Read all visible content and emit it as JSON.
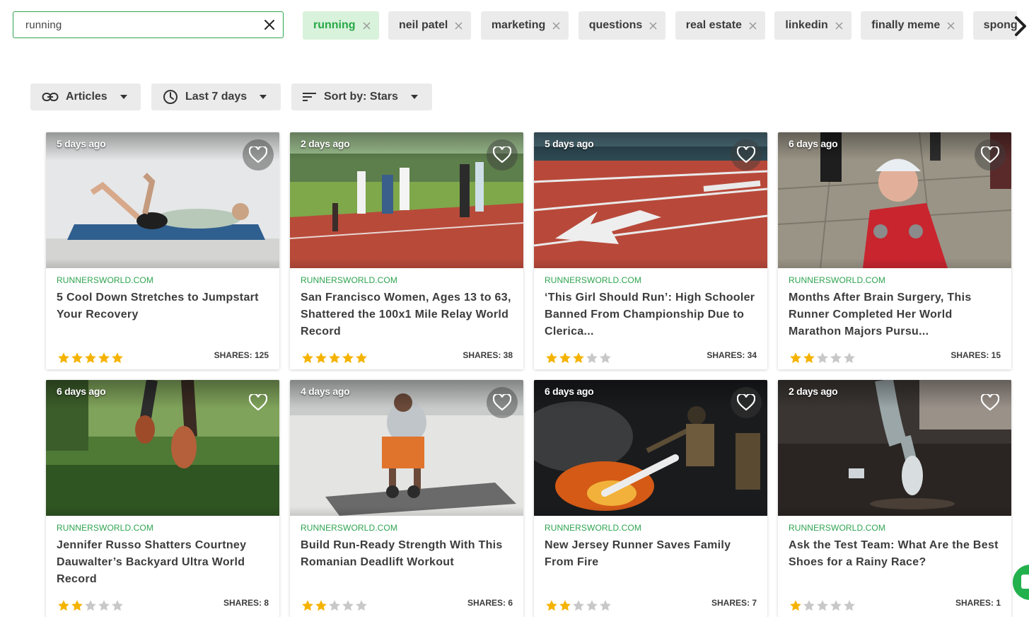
{
  "search": {
    "value": "running"
  },
  "chips": [
    {
      "label": "running",
      "active": true
    },
    {
      "label": "neil patel",
      "active": false
    },
    {
      "label": "marketing",
      "active": false
    },
    {
      "label": "questions",
      "active": false
    },
    {
      "label": "real estate",
      "active": false
    },
    {
      "label": "linkedin",
      "active": false
    },
    {
      "label": "finally meme",
      "active": false
    },
    {
      "label": "sponge",
      "active": false
    }
  ],
  "filters": {
    "type_label": "Articles",
    "time_label": "Last 7 days",
    "sort_label": "Sort by: Stars"
  },
  "cards": [
    {
      "ago": "5 days ago",
      "source": "RUNNERSWORLD.COM",
      "title": "5 Cool Down Stretches to Jumpstart Your Recovery",
      "stars": 5,
      "shares": "SHARES: 125"
    },
    {
      "ago": "2 days ago",
      "source": "RUNNERSWORLD.COM",
      "title": "San Francisco Women, Ages 13 to 63, Shattered the 100x1 Mile Relay World Record",
      "stars": 5,
      "shares": "SHARES: 38"
    },
    {
      "ago": "5 days ago",
      "source": "RUNNERSWORLD.COM",
      "title": "‘This Girl Should Run’: High Schooler Banned From Championship Due to Clerica...",
      "stars": 3,
      "shares": "SHARES: 34"
    },
    {
      "ago": "6 days ago",
      "source": "RUNNERSWORLD.COM",
      "title": "Months After Brain Surgery, This Runner Completed Her World Marathon Majors Pursu...",
      "stars": 2,
      "shares": "SHARES: 15"
    },
    {
      "ago": "6 days ago",
      "source": "RUNNERSWORLD.COM",
      "title": "Jennifer Russo Shatters Courtney Dauwalter’s Backyard Ultra World Record",
      "stars": 2,
      "shares": "SHARES: 8"
    },
    {
      "ago": "4 days ago",
      "source": "RUNNERSWORLD.COM",
      "title": "Build Run-Ready Strength With This Romanian Deadlift Workout",
      "stars": 2,
      "shares": "SHARES: 6"
    },
    {
      "ago": "6 days ago",
      "source": "RUNNERSWORLD.COM",
      "title": "New Jersey Runner Saves Family From Fire",
      "stars": 2,
      "shares": "SHARES: 7"
    },
    {
      "ago": "2 days ago",
      "source": "RUNNERSWORLD.COM",
      "title": "Ask the Test Team: What Are the Best Shoes for a Rainy Race?",
      "stars": 1,
      "shares": "SHARES: 1"
    }
  ],
  "colors": {
    "accent": "#2ea44f",
    "star_on": "#f5b301",
    "star_off": "#c8c8c8"
  }
}
